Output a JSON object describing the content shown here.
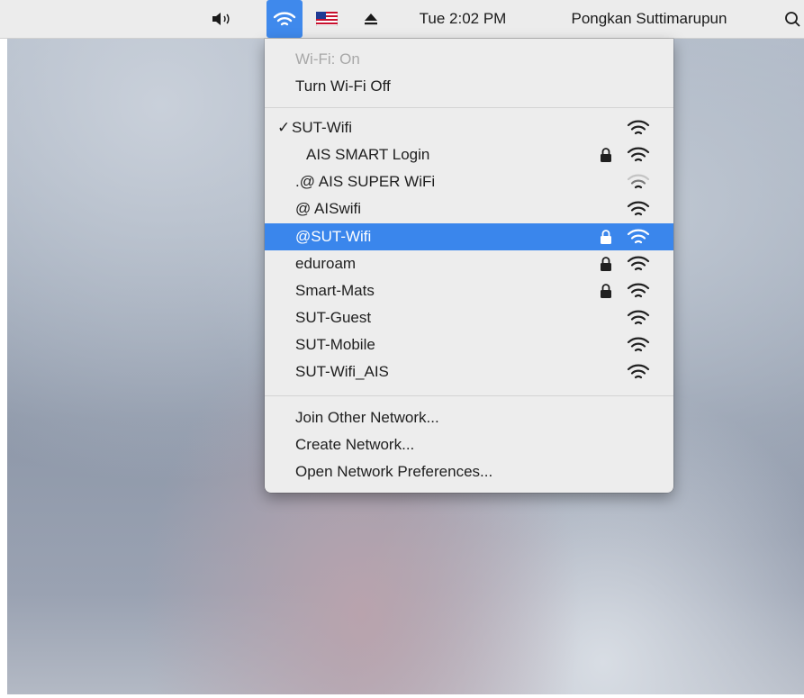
{
  "menubar": {
    "clock": "Tue 2:02 PM",
    "user": "Pongkan Suttimarupun",
    "volume_icon": "volume-icon",
    "wifi_icon": "wifi-icon",
    "flag_icon": "us-flag-icon",
    "eject_icon": "eject-icon",
    "search_icon": "spotlight-search-icon",
    "accent_color": "#3f89ec"
  },
  "wifi_menu": {
    "status": "Wi-Fi: On",
    "toggle": "Turn Wi-Fi Off",
    "networks": [
      {
        "name": "SUT-Wifi",
        "connected": true,
        "locked": false,
        "signal": "full"
      },
      {
        "name": "AIS SMART Login",
        "connected": false,
        "locked": true,
        "signal": "full"
      },
      {
        "name": ".@ AIS SUPER WiFi",
        "connected": false,
        "locked": false,
        "signal": "weak"
      },
      {
        "name": "@ AISwifi",
        "connected": false,
        "locked": false,
        "signal": "full"
      },
      {
        "name": "@SUT-Wifi",
        "connected": false,
        "locked": true,
        "signal": "full",
        "highlighted": true
      },
      {
        "name": "eduroam",
        "connected": false,
        "locked": true,
        "signal": "full"
      },
      {
        "name": "Smart-Mats",
        "connected": false,
        "locked": true,
        "signal": "full"
      },
      {
        "name": "SUT-Guest",
        "connected": false,
        "locked": false,
        "signal": "full"
      },
      {
        "name": "SUT-Mobile",
        "connected": false,
        "locked": false,
        "signal": "full"
      },
      {
        "name": "SUT-Wifi_AIS",
        "connected": false,
        "locked": false,
        "signal": "full"
      }
    ],
    "checkmark": "✓",
    "join_other": "Join Other Network...",
    "create": "Create Network...",
    "preferences": "Open Network Preferences...",
    "highlight_color": "#3a86ec"
  }
}
